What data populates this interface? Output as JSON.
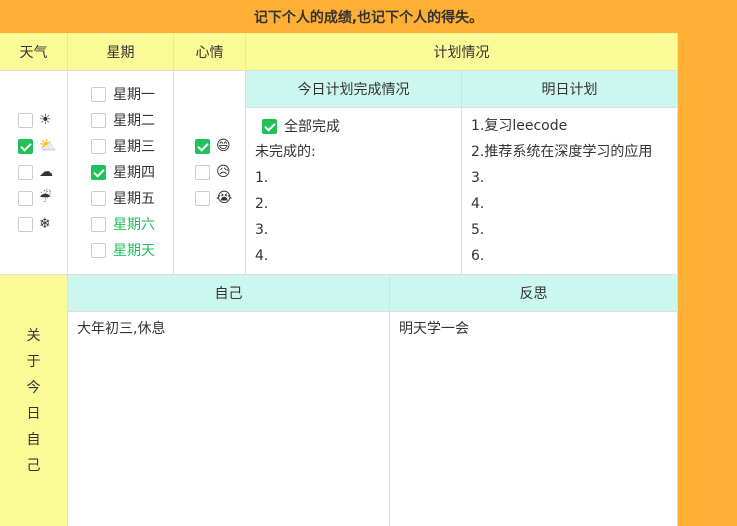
{
  "banner": "记下个人的成绩,也记下个人的得失。",
  "headers": {
    "weather": "天气",
    "weekday": "星期",
    "mood": "心情",
    "plan": "计划情况",
    "today_plan": "今日计划完成情况",
    "tomorrow_plan": "明日计划",
    "self": "自己",
    "reflect": "反思"
  },
  "weather": [
    {
      "icon": "☀",
      "name": "sun-icon",
      "checked": false
    },
    {
      "icon": "⛅",
      "name": "partly-cloudy-icon",
      "checked": true
    },
    {
      "icon": "☁",
      "name": "rain-cloud-icon",
      "checked": false
    },
    {
      "icon": "☔",
      "name": "umbrella-icon",
      "checked": false
    },
    {
      "icon": "❄",
      "name": "snowflake-icon",
      "checked": false
    }
  ],
  "weekdays": [
    {
      "label": "星期一",
      "checked": false,
      "weekend": false
    },
    {
      "label": "星期二",
      "checked": false,
      "weekend": false
    },
    {
      "label": "星期三",
      "checked": false,
      "weekend": false
    },
    {
      "label": "星期四",
      "checked": true,
      "weekend": false
    },
    {
      "label": "星期五",
      "checked": false,
      "weekend": false
    },
    {
      "label": "星期六",
      "checked": false,
      "weekend": true
    },
    {
      "label": "星期天",
      "checked": false,
      "weekend": true
    }
  ],
  "moods": [
    {
      "icon": "😄",
      "name": "happy-face-icon",
      "checked": true
    },
    {
      "icon": "😥",
      "name": "sad-face-icon",
      "checked": false
    },
    {
      "icon": "😭",
      "name": "crying-face-icon",
      "checked": false
    }
  ],
  "today": {
    "all_done_label": "全部完成",
    "all_done_checked": true,
    "unfinished_label": "未完成的:",
    "items": [
      "1.",
      "2.",
      "3.",
      "4."
    ]
  },
  "tomorrow": {
    "items": [
      "1.复习leecode",
      "2.推荐系统在深度学习的应用",
      "3.",
      "4.",
      "5.",
      "6."
    ]
  },
  "about": {
    "label_chars": [
      "关",
      "于",
      "今",
      "日",
      "自",
      "己"
    ]
  },
  "self_text": "大年初三,休息",
  "reflect_text": "明天学一会"
}
